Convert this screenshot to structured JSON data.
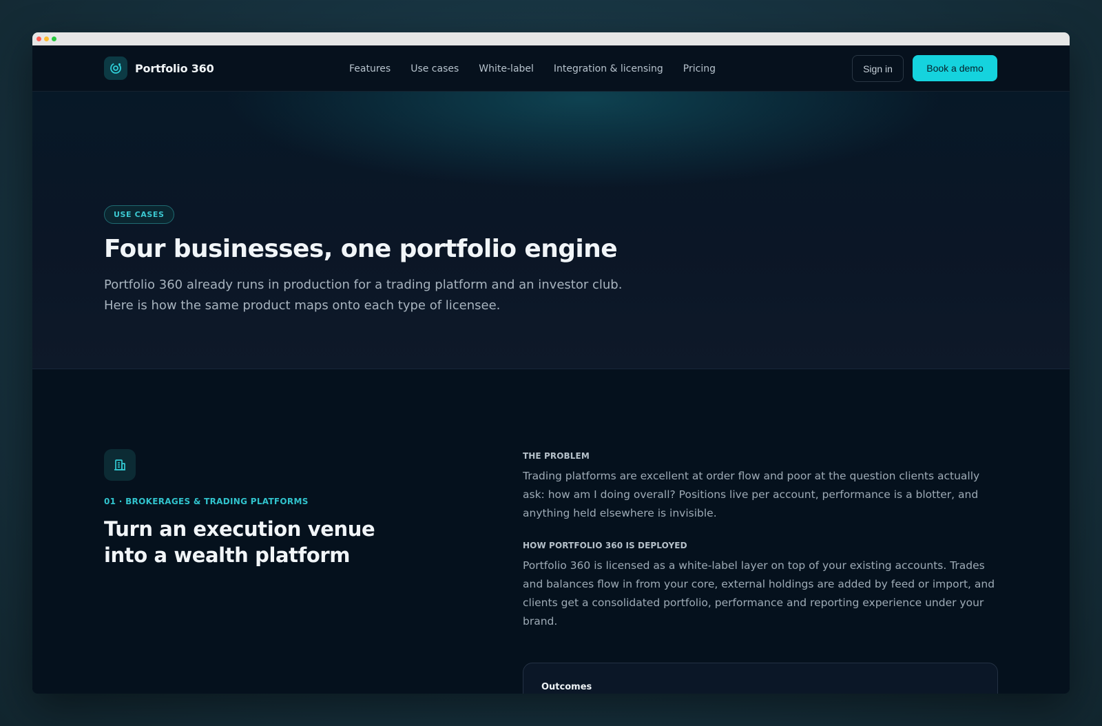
{
  "nav": {
    "brand": "Portfolio 360",
    "links": [
      "Features",
      "Use cases",
      "White-label",
      "Integration & licensing",
      "Pricing"
    ],
    "signin": "Sign in",
    "demo": "Book a demo"
  },
  "hero": {
    "pill": "USE CASES",
    "title": "Four businesses, one portfolio engine",
    "subtitle": "Portfolio 360 already runs in production for a trading platform and an investor club. Here is how the same product maps onto each type of licensee."
  },
  "case": {
    "icon": "building-icon",
    "tag": "01 · BROKERAGES & TRADING PLATFORMS",
    "title": "Turn an execution venue into a wealth platform",
    "problem_label": "THE PROBLEM",
    "problem_text": "Trading platforms are excellent at order flow and poor at the question clients actually ask: how am I doing overall? Positions live per account, performance is a blotter, and anything held elsewhere is invisible.",
    "deploy_label": "HOW PORTFOLIO 360 IS DEPLOYED",
    "deploy_text": "Portfolio 360 is licensed as a white-label layer on top of your existing accounts. Trades and balances flow in from your core, external holdings are added by feed or import, and clients get a consolidated portfolio, performance and reporting experience under your brand.",
    "outcomes_title": "Outcomes"
  },
  "colors": {
    "accent": "#15d3de",
    "background": "#06111d"
  }
}
